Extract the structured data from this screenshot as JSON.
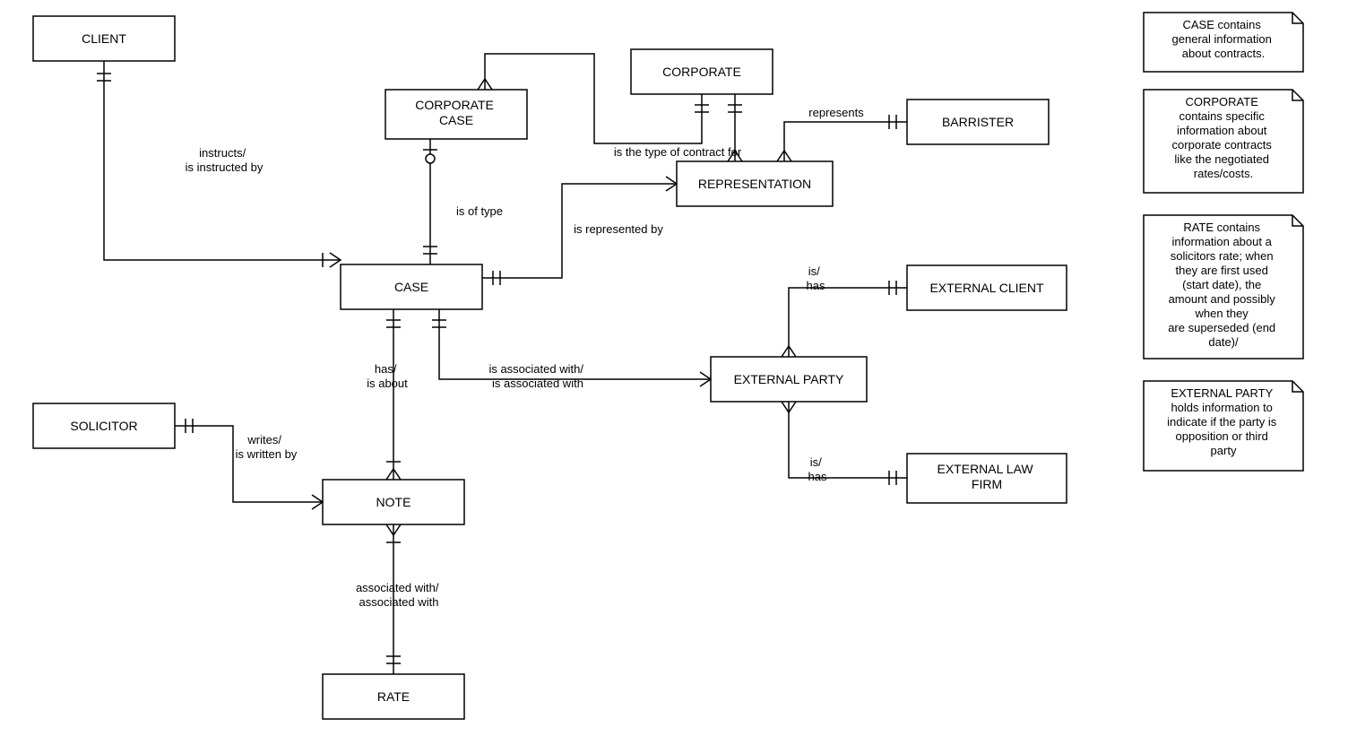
{
  "entities": {
    "client": "CLIENT",
    "corporate_case": "CORPORATE\nCASE",
    "corporate": "CORPORATE",
    "barrister": "BARRISTER",
    "representation": "REPRESENTATION",
    "case": "CASE",
    "external_client": "EXTERNAL CLIENT",
    "external_party": "EXTERNAL PARTY",
    "solicitor": "SOLICITOR",
    "note": "NOTE",
    "external_law_firm": "EXTERNAL LAW\nFIRM",
    "rate": "RATE"
  },
  "relations": {
    "instructs": "instructs/\nis instructed by",
    "is_of_type": "is of type",
    "type_of_contract": "is the type of contract for",
    "represents": "represents",
    "is_represented_by": "is represented by",
    "has_is_about": "has/\nis about",
    "associated_with": "is associated with/\nis associated with",
    "is_has_1": "is/\nhas",
    "is_has_2": "is/\nhas",
    "writes": "writes/\nis written by",
    "assoc_rate": "associated with/\nassociated with"
  },
  "notes": {
    "n1": "CASE contains\ngeneral information\nabout contracts.",
    "n2": "CORPORATE\ncontains specific\ninformation about\ncorporate contracts\nlike the negotiated\nrates/costs.",
    "n3": "RATE contains\ninformation about a\nsolicitors rate; when\nthey are first used\n(start date), the\namount and possibly\nwhen they\nare superseded (end\ndate)/",
    "n4": "EXTERNAL PARTY\nholds information to\nindicate if the party is\nopposition or third\nparty"
  }
}
